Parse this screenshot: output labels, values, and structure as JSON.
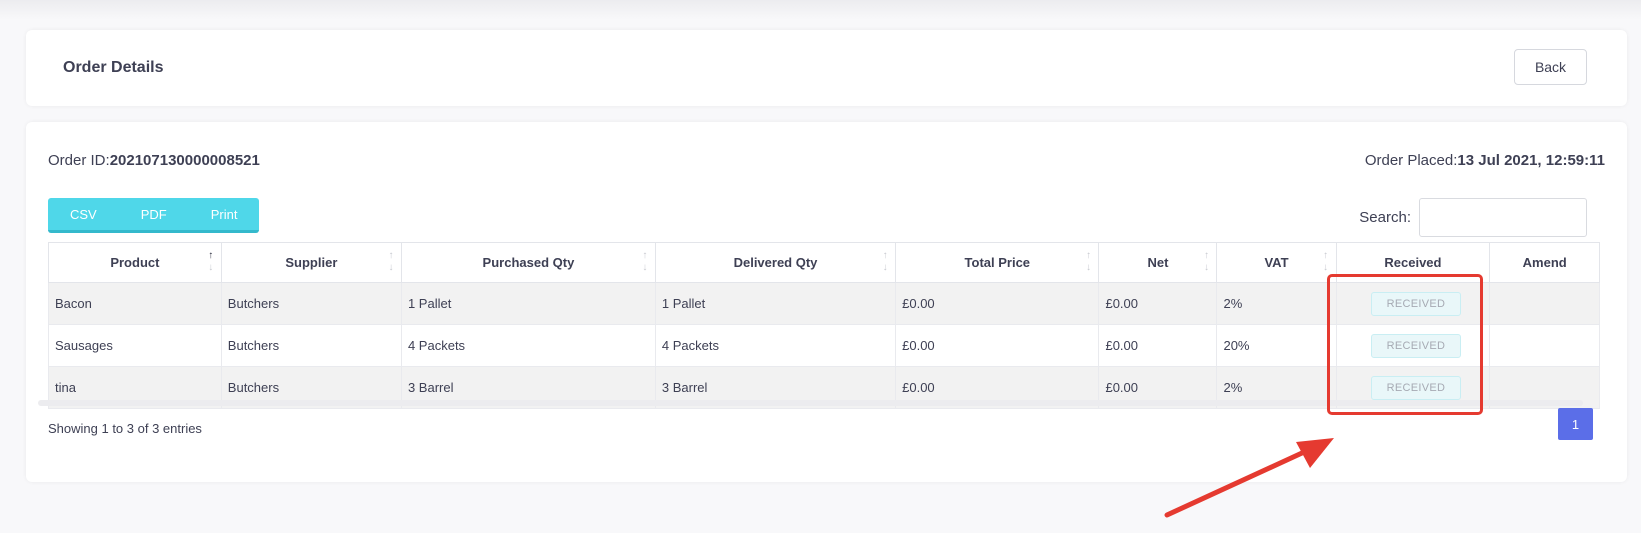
{
  "header": {
    "title": "Order Details",
    "back_label": "Back"
  },
  "order": {
    "id_label": "Order ID:",
    "id_value": "202107130000008521",
    "placed_label": "Order Placed:",
    "placed_value": "13 Jul 2021, 12:59:11"
  },
  "toolbar": {
    "csv_label": "CSV",
    "pdf_label": "PDF",
    "print_label": "Print",
    "search_label": "Search:",
    "search_value": ""
  },
  "table": {
    "columns": [
      "Product",
      "Supplier",
      "Purchased Qty",
      "Delivered Qty",
      "Total Price",
      "Net",
      "VAT",
      "Received",
      "Amend"
    ],
    "rows": [
      {
        "product": "Bacon",
        "supplier": "Butchers",
        "purchased": "1 Pallet",
        "delivered": "1 Pallet",
        "total": "£0.00",
        "net": "£0.00",
        "vat": "2%",
        "received": "RECEIVED",
        "amend": ""
      },
      {
        "product": "Sausages",
        "supplier": "Butchers",
        "purchased": "4 Packets",
        "delivered": "4 Packets",
        "total": "£0.00",
        "net": "£0.00",
        "vat": "20%",
        "received": "RECEIVED",
        "amend": ""
      },
      {
        "product": "tina",
        "supplier": "Butchers",
        "purchased": "3 Barrel",
        "delivered": "3 Barrel",
        "total": "£0.00",
        "net": "£0.00",
        "vat": "2%",
        "received": "RECEIVED",
        "amend": ""
      }
    ]
  },
  "footer": {
    "entries_text": "Showing 1 to 3 of 3 entries",
    "current_page": "1"
  },
  "colors": {
    "export_button": "#4fd7e9",
    "pagination_active": "#5b6ee8",
    "annotation": "#e53a30"
  },
  "icons": {
    "sort": "sort-arrows-icon",
    "annotation_arrow": "red-arrow-icon"
  }
}
